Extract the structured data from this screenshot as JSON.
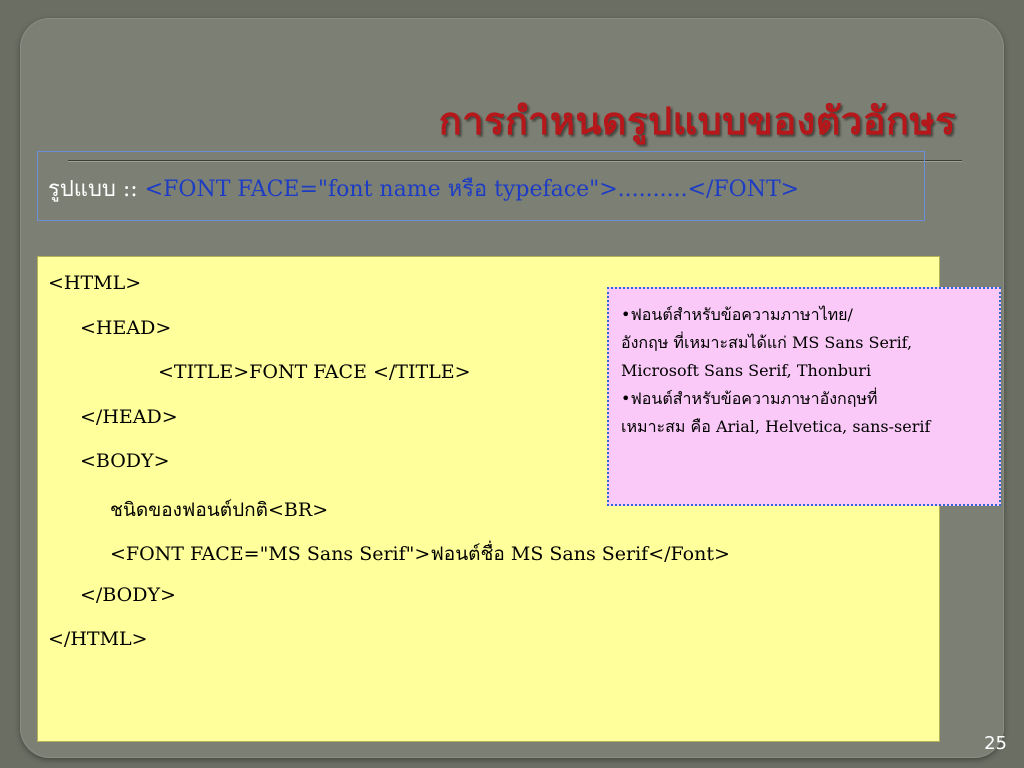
{
  "slide": {
    "title": "การกำหนดรูปแบบของตัวอักษร",
    "page_number": "25"
  },
  "format": {
    "label": "รูปแบบ :: ",
    "syntax": "<FONT FACE=\"font name หรือ typeface\">..........</FONT>"
  },
  "code_lines": [
    "<HTML>",
    "<HEAD>",
    "<TITLE>FONT FACE </TITLE>",
    "</HEAD>",
    "<BODY>",
    "ชนิดของฟอนต์ปกติ",
    "<BR>",
    "<FONT FACE=\"MS Sans Serif\">",
    "ฟอนต์ชื่อ",
    " MS Sans Serif</Font>",
    "</BODY>",
    "</HTML>"
  ],
  "note": {
    "lines": [
      "•ฟอนต์สำหรับข้อความภาษาไทย/",
      "อังกฤษ ที่เหมาะสมได้แก่ MS Sans Serif,",
      "Microsoft Sans Serif, Thonburi",
      "•ฟอนต์สำหรับข้อความภาษาอังกฤษที่",
      "เหมาะสม คือ Arial, Helvetica, sans-serif"
    ]
  },
  "colors": {
    "background": "#6b6e63",
    "title": "#b5171b",
    "syntax": "#1d3cc4",
    "code_background": "#ffff9b",
    "note_background": "#fac9f7"
  }
}
